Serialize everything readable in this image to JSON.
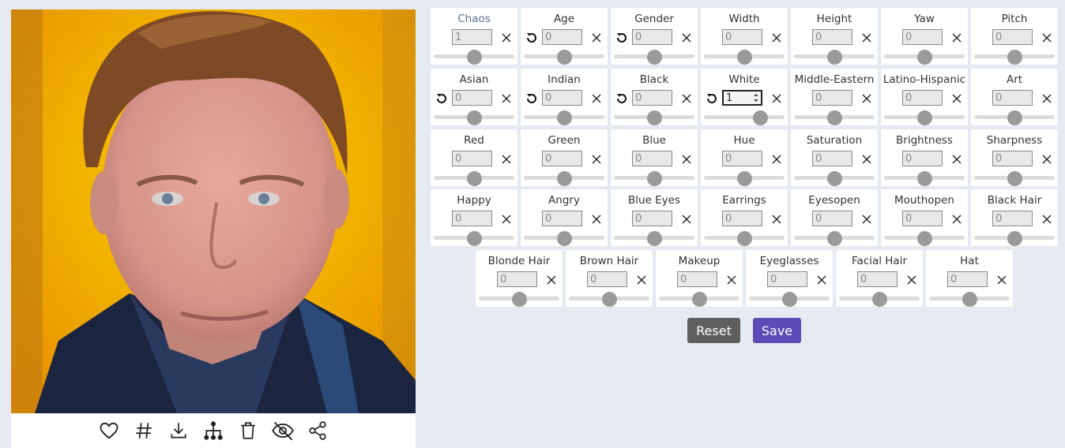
{
  "rows": [
    [
      {
        "label": "Chaos",
        "value": "1",
        "knob": 0.5,
        "reset": false,
        "link": true
      },
      {
        "label": "Age",
        "value": "0",
        "knob": 0.5,
        "reset": true
      },
      {
        "label": "Gender",
        "value": "0",
        "knob": 0.5,
        "reset": true
      },
      {
        "label": "Width",
        "value": "0",
        "knob": 0.5,
        "reset": false
      },
      {
        "label": "Height",
        "value": "0",
        "knob": 0.5,
        "reset": false
      },
      {
        "label": "Yaw",
        "value": "0",
        "knob": 0.5,
        "reset": false
      },
      {
        "label": "Pitch",
        "value": "0",
        "knob": 0.5,
        "reset": false
      }
    ],
    [
      {
        "label": "Asian",
        "value": "0",
        "knob": 0.5,
        "reset": true
      },
      {
        "label": "Indian",
        "value": "0",
        "knob": 0.5,
        "reset": true
      },
      {
        "label": "Black",
        "value": "0",
        "knob": 0.5,
        "reset": true
      },
      {
        "label": "White",
        "value": "1",
        "knob": 0.7,
        "reset": true,
        "active": true
      },
      {
        "label": "Middle-Eastern",
        "value": "0",
        "knob": 0.5,
        "reset": false
      },
      {
        "label": "Latino-Hispanic",
        "value": "0",
        "knob": 0.5,
        "reset": false
      },
      {
        "label": "Art",
        "value": "0",
        "knob": 0.5,
        "reset": false
      }
    ],
    [
      {
        "label": "Red",
        "value": "0",
        "knob": 0.5,
        "reset": false
      },
      {
        "label": "Green",
        "value": "0",
        "knob": 0.5,
        "reset": false
      },
      {
        "label": "Blue",
        "value": "0",
        "knob": 0.5,
        "reset": false
      },
      {
        "label": "Hue",
        "value": "0",
        "knob": 0.5,
        "reset": false
      },
      {
        "label": "Saturation",
        "value": "0",
        "knob": 0.5,
        "reset": false
      },
      {
        "label": "Brightness",
        "value": "0",
        "knob": 0.5,
        "reset": false
      },
      {
        "label": "Sharpness",
        "value": "0",
        "knob": 0.5,
        "reset": false
      }
    ],
    [
      {
        "label": "Happy",
        "value": "0",
        "knob": 0.5,
        "reset": false
      },
      {
        "label": "Angry",
        "value": "0",
        "knob": 0.5,
        "reset": false
      },
      {
        "label": "Blue Eyes",
        "value": "0",
        "knob": 0.5,
        "reset": false
      },
      {
        "label": "Earrings",
        "value": "0",
        "knob": 0.5,
        "reset": false
      },
      {
        "label": "Eyesopen",
        "value": "0",
        "knob": 0.5,
        "reset": false
      },
      {
        "label": "Mouthopen",
        "value": "0",
        "knob": 0.5,
        "reset": false
      },
      {
        "label": "Black Hair",
        "value": "0",
        "knob": 0.5,
        "reset": false
      }
    ],
    [
      {
        "label": "Blonde Hair",
        "value": "0",
        "knob": 0.5,
        "reset": false
      },
      {
        "label": "Brown Hair",
        "value": "0",
        "knob": 0.5,
        "reset": false
      },
      {
        "label": "Makeup",
        "value": "0",
        "knob": 0.5,
        "reset": false
      },
      {
        "label": "Eyeglasses",
        "value": "0",
        "knob": 0.5,
        "reset": false
      },
      {
        "label": "Facial Hair",
        "value": "0",
        "knob": 0.5,
        "reset": false
      },
      {
        "label": "Hat",
        "value": "0",
        "knob": 0.5,
        "reset": false
      }
    ]
  ],
  "buttons": {
    "reset": "Reset",
    "save": "Save"
  },
  "toolbar": [
    "heart-icon",
    "hash-icon",
    "download-icon",
    "tree-icon",
    "trash-icon",
    "hide-icon",
    "share-icon"
  ],
  "colors": {
    "accent": "#5b4cb8",
    "reset_button": "#5f5f5f",
    "background": "#e6eaf1"
  }
}
